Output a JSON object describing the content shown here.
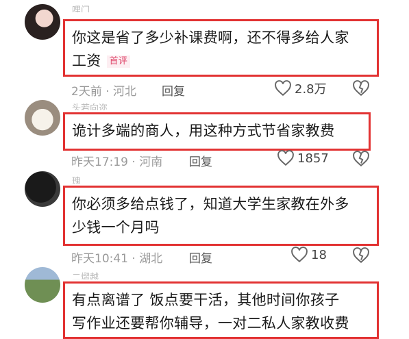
{
  "comments": [
    {
      "username": "哩门",
      "text_line1": "你这是省了多少补课费啊，还不得多给人家",
      "text_line2": "工资",
      "tag": "首评",
      "time_location": "2天前 · 河北",
      "reply_label": "回复",
      "likes": "2.8万",
      "avatar_icon": "user-avatar"
    },
    {
      "username": "头若向迩",
      "text_line1": "诡计多端的商人，用这种方式节省家教费",
      "time_location": "昨天17:19 · 河南",
      "reply_label": "回复",
      "likes": "1857",
      "avatar_icon": "dog-avatar"
    },
    {
      "username": "瑰",
      "text_line1": "你必须多给点钱了，知道大学生家教在外多",
      "text_line2": "少钱一个月吗",
      "time_location": "昨天10:41 · 湖北",
      "reply_label": "回复",
      "likes": "18",
      "avatar_icon": "cat-avatar"
    },
    {
      "username": "二熠越",
      "text_line1": "有点离谱了 饭点要干活，其他时间你孩子",
      "text_line2": "写作业还要帮你辅导，一对二私人家教收费",
      "avatar_icon": "landscape-avatar"
    }
  ],
  "colors": {
    "highlight_border": "#e23232",
    "tag_text": "#e04b6e"
  }
}
